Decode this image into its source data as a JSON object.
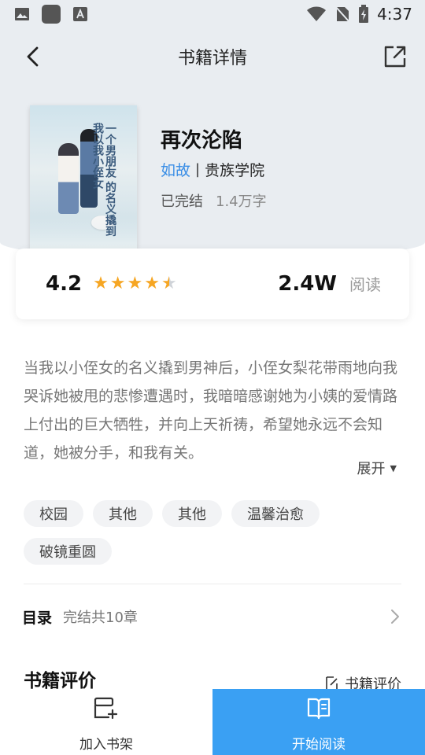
{
  "status_bar": {
    "time": "4:37"
  },
  "nav": {
    "title": "书籍详情"
  },
  "book": {
    "title": "再次沦陷",
    "author": "如故",
    "separator": "|",
    "category": "贵族学院",
    "status": "已完结",
    "word_count": "1.4万字",
    "cover_text": "一个男朋友 的名义撬到 我以我小侄女"
  },
  "rating": {
    "score": "4.2",
    "stars": 4.5,
    "read_count": "2.4W",
    "read_label": "阅读"
  },
  "synopsis": {
    "text": "当我以小侄女的名义撬到男神后，小侄女梨花带雨地向我哭诉她被甩的悲惨遭遇时，我暗暗感谢她为小姨的爱情路上付出的巨大牺牲，并向上天祈祷，希望她永远不会知道，她被分手，和我有关。",
    "expand_label": "展开"
  },
  "tags": [
    "校园",
    "其他",
    "其他",
    "温馨治愈",
    "破镜重圆"
  ],
  "toc": {
    "label": "目录",
    "info": "完结共10章"
  },
  "review": {
    "title": "书籍评价",
    "link_label": "书籍评价"
  },
  "bottom": {
    "shelf_label": "加入书架",
    "read_label": "开始阅读"
  },
  "colors": {
    "accent": "#3aa0f3",
    "author_link": "#3a8ee6",
    "star": "#f6a623",
    "header_bg": "#e9edf1"
  }
}
